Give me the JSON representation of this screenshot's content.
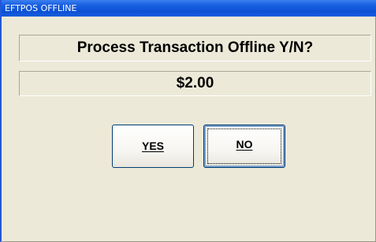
{
  "window": {
    "title": "EFTPOS OFFLINE"
  },
  "dialog": {
    "prompt": "Process Transaction Offline Y/N?",
    "amount": "$2.00"
  },
  "buttons": {
    "yes_label": "YES",
    "no_label": "NO"
  },
  "colors": {
    "title_bar": "#0c52d6",
    "background": "#ece9d8",
    "button_border": "#003c74"
  }
}
